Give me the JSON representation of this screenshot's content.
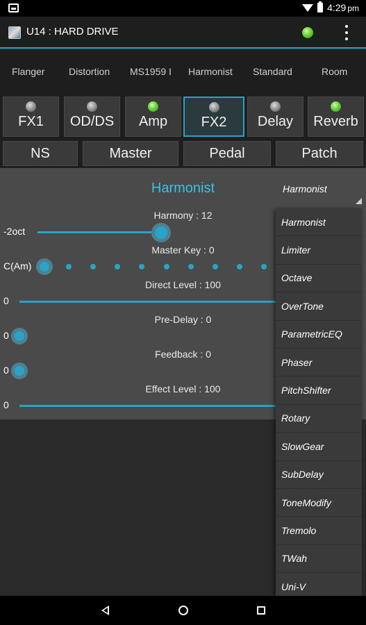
{
  "status_bar": {
    "time": "4:29",
    "time_suffix": "pm"
  },
  "app": {
    "title": "U14 : HARD DRIVE"
  },
  "effect_names": [
    "Flanger",
    "Distortion",
    "MS1959 I",
    "Harmonist",
    "Standard",
    "Room"
  ],
  "fx_buttons": [
    {
      "label": "FX1",
      "led": "off"
    },
    {
      "label": "OD/DS",
      "led": "off"
    },
    {
      "label": "Amp",
      "led": "on"
    },
    {
      "label": "FX2",
      "led": "off",
      "selected": true
    },
    {
      "label": "Delay",
      "led": "off"
    },
    {
      "label": "Reverb",
      "led": "on"
    }
  ],
  "sub_buttons": [
    "NS",
    "Master",
    "Pedal",
    "Patch"
  ],
  "panel": {
    "title": "Harmonist",
    "selected_type": "Harmonist",
    "params": [
      {
        "label": "Harmony : 12",
        "min": "-2oct",
        "value_fraction": 0.5
      },
      {
        "label": "Master Key : 0",
        "min": "C(Am)",
        "value_fraction": 0.0
      },
      {
        "label": "Direct Level : 100",
        "min": "0",
        "value_fraction": 1.0
      },
      {
        "label": "Pre-Delay : 0",
        "min": "0",
        "value_fraction": 0.0
      },
      {
        "label": "Feedback : 0",
        "min": "0",
        "value_fraction": 0.0
      },
      {
        "label": "Effect Level : 100",
        "min": "0",
        "value_fraction": 1.0
      }
    ]
  },
  "dropdown_options": [
    "Harmonist",
    "Limiter",
    "Octave",
    "OverTone",
    "ParametricEQ",
    "Phaser",
    "PitchShifter",
    "Rotary",
    "SlowGear",
    "SubDelay",
    "ToneModify",
    "Tremolo",
    "TWah",
    "Uni-V"
  ],
  "colors": {
    "accent": "#2aa3c8",
    "title": "#33c4e6",
    "led_on": "#6ad23a"
  }
}
